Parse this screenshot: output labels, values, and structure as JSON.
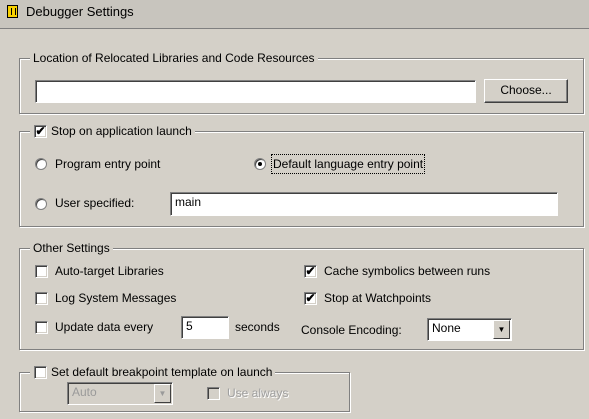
{
  "window": {
    "title": "Debugger Settings"
  },
  "location_group": {
    "legend": "Location of Relocated Libraries and Code Resources",
    "path_value": "",
    "choose_label": "Choose..."
  },
  "launch_group": {
    "legend": "Stop on application launch",
    "stop_checked": "✔",
    "program_entry_label": "Program entry point",
    "default_language_label": "Default language entry point",
    "user_specified_label": "User specified:",
    "user_specified_value": "main"
  },
  "other_group": {
    "legend": "Other Settings",
    "auto_target_label": "Auto-target Libraries",
    "log_messages_label": "Log System Messages",
    "update_every_label": "Update data every",
    "update_every_value": "5",
    "seconds_label": "seconds",
    "cache_symbolics_label": "Cache symbolics between runs",
    "cache_symbolics_checked": "✔",
    "stop_watchpoints_label": "Stop at Watchpoints",
    "stop_watchpoints_checked": "✔",
    "console_encoding_label": "Console Encoding:",
    "console_encoding_value": "None"
  },
  "breakpoint_group": {
    "legend": "Set default breakpoint template on launch",
    "template_value": "Auto",
    "use_always_label": "Use always"
  },
  "icons": {
    "header": "debugger-icon",
    "dropdown": "chevron-down-icon"
  }
}
